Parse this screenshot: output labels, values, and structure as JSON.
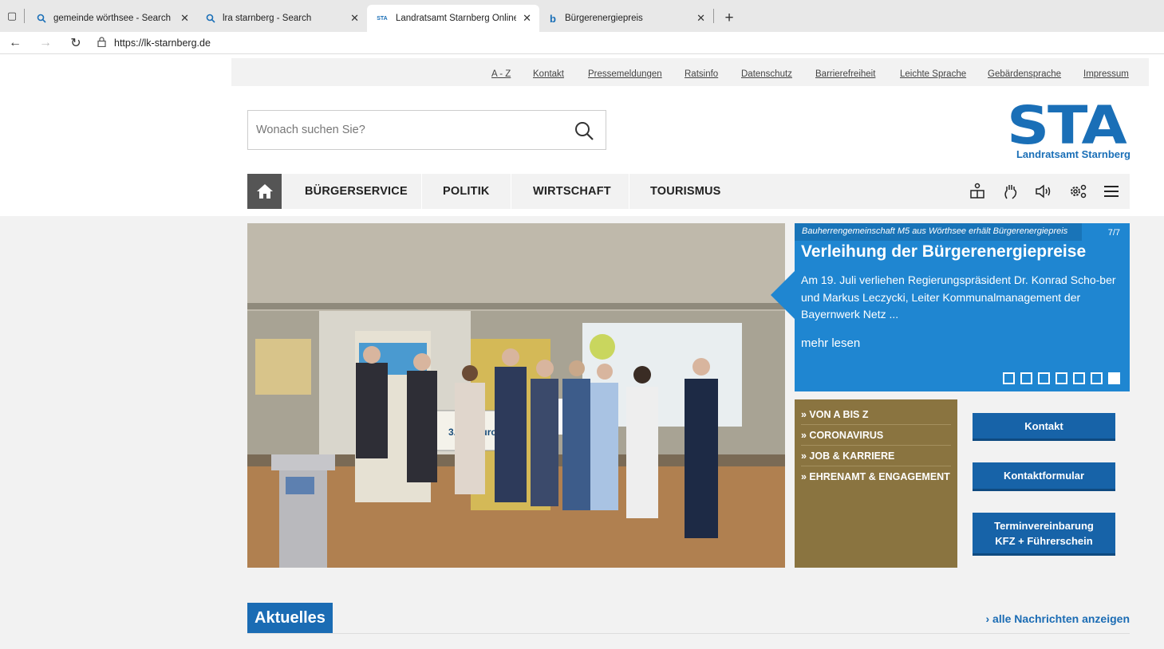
{
  "browser": {
    "tabs": [
      {
        "title": "gemeinde wörthsee - Search",
        "icon": "search-icon",
        "active": false
      },
      {
        "title": "lra starnberg - Search",
        "icon": "search-icon",
        "active": false
      },
      {
        "title": "Landratsamt Starnberg Online",
        "icon": "sta-favicon",
        "fav_text": "STA",
        "active": true
      },
      {
        "title": "Bürgerenergiepreis",
        "icon": "bing-icon",
        "fav_text": "b",
        "active": false
      }
    ],
    "url": "https://lk-starnberg.de"
  },
  "topnav": [
    "A - Z",
    "Kontakt",
    "Pressemeldungen",
    "Ratsinfo",
    "Datenschutz",
    "Barrierefreiheit",
    "Leichte Sprache",
    "Gebärdensprache",
    "Impressum"
  ],
  "search": {
    "placeholder": "Wonach suchen Sie?"
  },
  "logo": {
    "mark": "STA",
    "subtitle": "Landratsamt Starnberg"
  },
  "mainnav": {
    "items": [
      "BÜRGERSERVICE",
      "POLITIK",
      "WIRTSCHAFT",
      "TOURISMUS"
    ],
    "tools": [
      "leichte-sprache-icon",
      "gebaerdensprache-icon",
      "vorlesen-icon",
      "settings-icon",
      "menu-icon"
    ]
  },
  "hero": {
    "image_text": {
      "cheque": "3.000 Euro"
    },
    "kicker": "Bauherrengemeinschaft M5 aus Wörthsee erhält Bürgerenergiepreis",
    "counter": "7/7",
    "title": "Verleihung der Bürgerenergiepreise",
    "text": "Am 19. Juli verliehen Regierungspräsident Dr. Konrad Scho-ber und Markus Leczycki, Leiter Kommunalmanagement der Bayernwerk Netz ...",
    "more": "mehr lesen",
    "slides_total": 7,
    "slide_active": 7
  },
  "quicklinks": [
    "» VON A BIS Z",
    "» CORONAVIRUS",
    "» JOB & KARRIERE",
    "» EHRENAMT & ENGAGEMENT"
  ],
  "contact_buttons": [
    "Kontakt",
    "Kontaktformular",
    "Terminvereinbarung KFZ + Führerschein"
  ],
  "news": {
    "heading": "Aktuelles",
    "all_link": "› alle Nachrichten anzeigen"
  },
  "colors": {
    "brand_blue": "#1a6fb7",
    "slider_blue": "#1f86d1",
    "quicklinks_brown": "#8a7440",
    "button_blue": "#1763a8"
  }
}
